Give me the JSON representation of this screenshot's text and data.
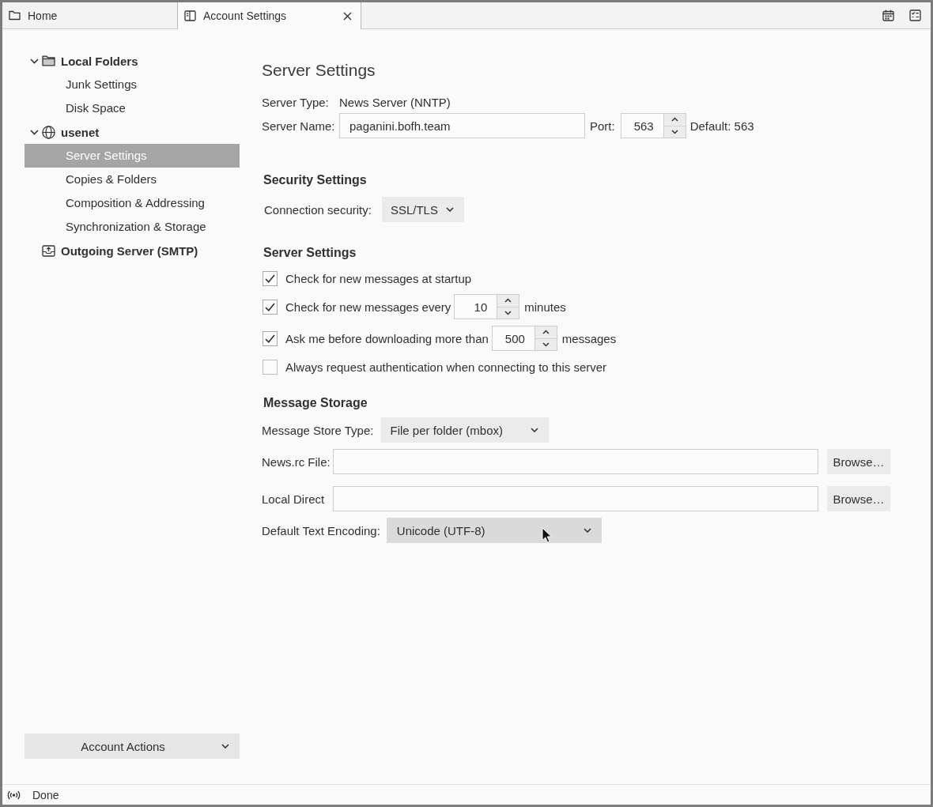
{
  "tabs": [
    {
      "label": "Home",
      "kind": "folder",
      "selected": false,
      "closable": false
    },
    {
      "label": "Account Settings",
      "kind": "settings",
      "selected": true,
      "closable": true
    }
  ],
  "sidebar": {
    "accounts": [
      {
        "label": "Local Folders",
        "kind": "folder",
        "expanded": true,
        "selected": false,
        "children": [
          {
            "label": "Junk Settings",
            "selected": false
          },
          {
            "label": "Disk Space",
            "selected": false
          }
        ]
      },
      {
        "label": "usenet",
        "kind": "news",
        "expanded": true,
        "selected": false,
        "children": [
          {
            "label": "Server Settings",
            "selected": true
          },
          {
            "label": "Copies & Folders",
            "selected": false
          },
          {
            "label": "Composition & Addressing",
            "selected": false
          },
          {
            "label": "Synchronization & Storage",
            "selected": false
          }
        ]
      },
      {
        "label": "Outgoing Server (SMTP)",
        "kind": "smtp",
        "selected": false
      }
    ],
    "actions_button": "Account Actions"
  },
  "main": {
    "title": "Server Settings",
    "server_type": {
      "label": "Server Type:",
      "value": "News Server (NNTP)"
    },
    "server_name": {
      "label": "Server Name:",
      "value": "paganini.bofh.team"
    },
    "port": {
      "label": "Port:",
      "value": "563",
      "default": "Default: 563"
    },
    "security": {
      "heading": "Security Settings",
      "label": "Connection security:",
      "value": "SSL/TLS"
    },
    "server_settings": {
      "heading": "Server Settings",
      "options": [
        {
          "kind": "plain",
          "label": "Check for new messages at startup",
          "checked": true
        },
        {
          "kind": "number",
          "label": "Check for new messages every",
          "value": "10",
          "unit": "minutes",
          "checked": true
        },
        {
          "kind": "number",
          "label": "Ask me before downloading more than",
          "value": "500",
          "unit": "messages",
          "checked": true
        },
        {
          "kind": "plain",
          "label": "Always request authentication when connecting to this server",
          "checked": false
        }
      ]
    },
    "storage": {
      "heading": "Message Storage",
      "store_type": {
        "label": "Message Store Type:",
        "value": "File per folder (mbox)"
      },
      "files": [
        {
          "label": "News.rc File:",
          "button": "Browse…"
        },
        {
          "label": "Local Direct",
          "button": "Browse…"
        }
      ],
      "encoding": {
        "label": "Default Text Encoding:",
        "value": "Unicode (UTF-8)",
        "hovered": true
      }
    }
  },
  "status_bar": {
    "text": "Done"
  }
}
